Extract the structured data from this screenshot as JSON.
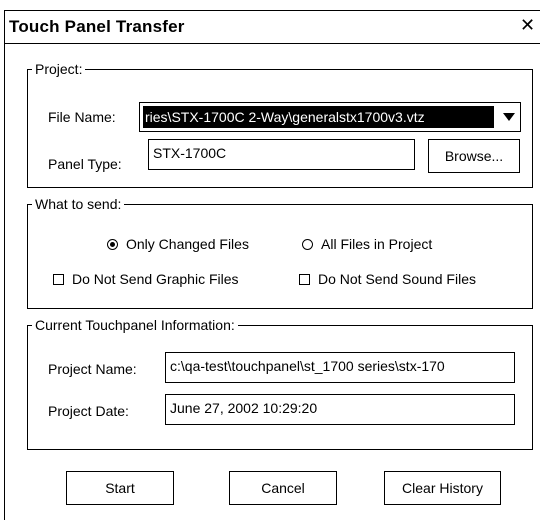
{
  "window": {
    "title": "Touch Panel Transfer",
    "close_glyph": "✕"
  },
  "project": {
    "legend": "Project:",
    "file_name_label": "File Name:",
    "file_name_value": "ries\\STX-1700C 2-Way\\generalstx1700v3.vtz",
    "panel_type_label": "Panel Type:",
    "panel_type_value": "STX-1700C",
    "browse_label": "Browse..."
  },
  "what_to_send": {
    "legend": "What to send:",
    "only_changed": {
      "label": "Only Changed Files",
      "selected": true
    },
    "all_files": {
      "label": "All Files in Project",
      "selected": false
    },
    "no_graphics": {
      "label": "Do Not Send Graphic Files",
      "checked": false
    },
    "no_sound": {
      "label": "Do Not Send Sound Files",
      "checked": false
    }
  },
  "touchpanel_info": {
    "legend": "Current Touchpanel Information:",
    "project_name_label": "Project Name:",
    "project_name_value": "c:\\qa-test\\touchpanel\\st_1700 series\\stx-170",
    "project_date_label": "Project Date:",
    "project_date_value": "June 27, 2002 10:29:20"
  },
  "buttons": {
    "start": "Start",
    "cancel": "Cancel",
    "clear_history": "Clear History"
  },
  "icons": {
    "close": "close-icon",
    "dropdown": "chevron-down-icon"
  }
}
